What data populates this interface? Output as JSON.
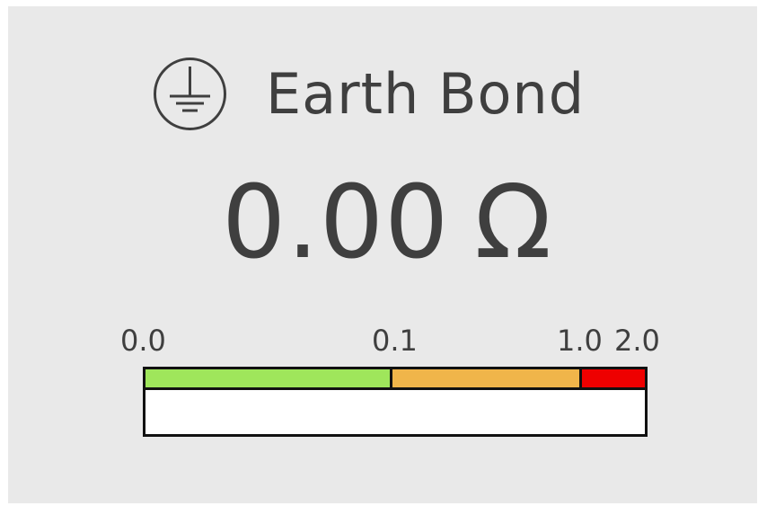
{
  "title": "Earth Bond",
  "icon": "earth-ground-icon",
  "reading": {
    "value": "0.00",
    "unit": "Ω"
  },
  "scale": {
    "labels": [
      "0.0",
      "0.1",
      "1.0",
      "2.0"
    ],
    "bands": [
      {
        "name": "good",
        "from": "0.0",
        "to": "0.1",
        "color": "#9fe65b"
      },
      {
        "name": "warning",
        "from": "0.1",
        "to": "1.0",
        "color": "#f0b54a"
      },
      {
        "name": "fail",
        "from": "1.0",
        "to": "2.0",
        "color": "#ee0000"
      }
    ]
  },
  "meter_fill_fraction": 0.0,
  "colors": {
    "background": "#e9e9e9",
    "text": "#3f3f3f",
    "meter_border": "#111111",
    "meter_background": "#ffffff"
  }
}
